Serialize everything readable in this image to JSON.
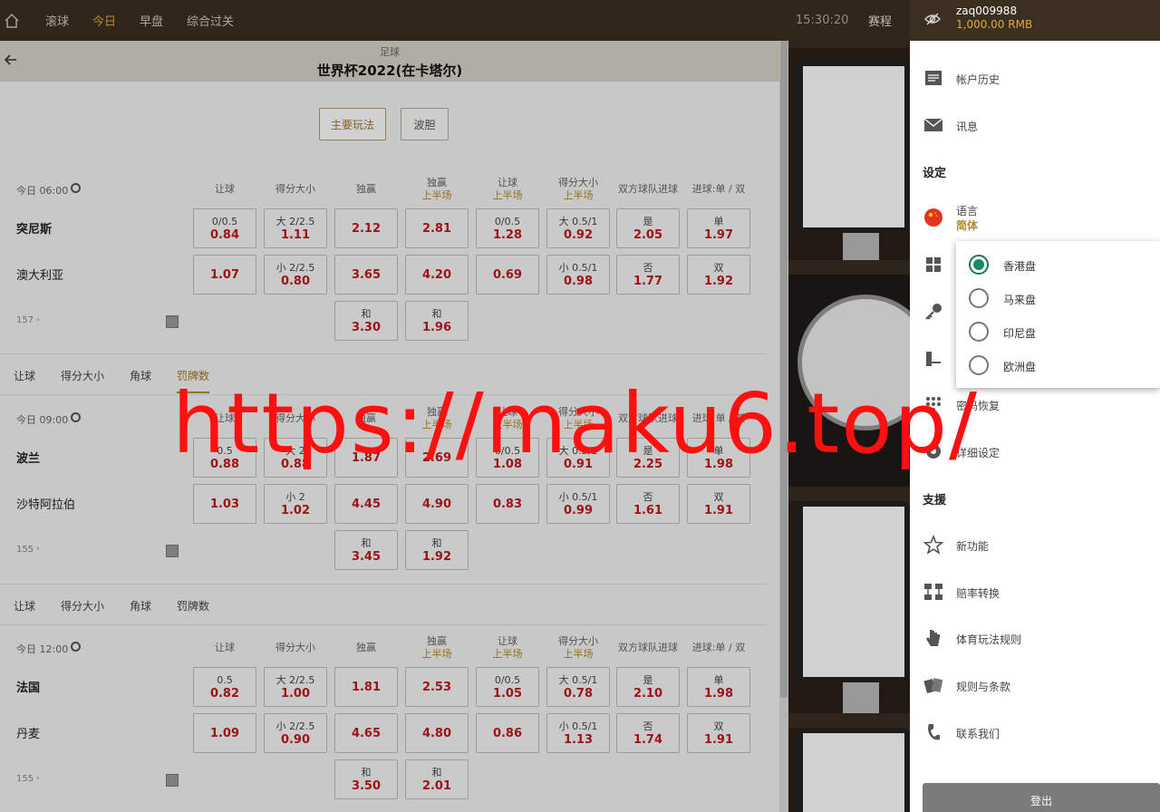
{
  "nav": {
    "items": [
      "滚球",
      "今日",
      "早盘",
      "综合过关"
    ],
    "active": 1,
    "time": "15:30:20",
    "schedule": "赛程"
  },
  "header": {
    "sport": "足球",
    "title": "世界杯2022(在卡塔尔)"
  },
  "tabs": {
    "main": "主要玩法",
    "correct_score": "波胆"
  },
  "columns": [
    {
      "l1": "让球",
      "l2": ""
    },
    {
      "l1": "得分大小",
      "l2": ""
    },
    {
      "l1": "独赢",
      "l2": ""
    },
    {
      "l1": "独赢",
      "l2": "上半场"
    },
    {
      "l1": "让球",
      "l2": "上半场"
    },
    {
      "l1": "得分大小",
      "l2": "上半场"
    },
    {
      "l1": "双方球队进球",
      "l2": ""
    },
    {
      "l1": "进球:单 / 双",
      "l2": ""
    }
  ],
  "matches": [
    {
      "time": "今日 06:00",
      "team1": "突尼斯",
      "team2": "澳大利亚",
      "more": "157",
      "row1": [
        [
          "0/0.5",
          "0.84"
        ],
        [
          "大 2/2.5",
          "1.11"
        ],
        [
          "",
          "2.12"
        ],
        [
          "",
          "2.81"
        ],
        [
          "0/0.5",
          "1.28"
        ],
        [
          "大 0.5/1",
          "0.92"
        ],
        [
          "是",
          "2.05"
        ],
        [
          "单",
          "1.97"
        ]
      ],
      "row2": [
        [
          "",
          "1.07"
        ],
        [
          "小 2/2.5",
          "0.80"
        ],
        [
          "",
          "3.65"
        ],
        [
          "",
          "4.20"
        ],
        [
          "",
          "0.69"
        ],
        [
          "小 0.5/1",
          "0.98"
        ],
        [
          "否",
          "1.77"
        ],
        [
          "双",
          "1.92"
        ]
      ],
      "draw": [
        [
          "和",
          "3.30"
        ],
        [
          "和",
          "1.96"
        ]
      ]
    },
    {
      "time": "今日 09:00",
      "team1": "波兰",
      "team2": "沙特阿拉伯",
      "more": "155",
      "row1": [
        [
          "0.5",
          "0.88"
        ],
        [
          "大 2",
          "0.88"
        ],
        [
          "",
          "1.87"
        ],
        [
          "",
          "2.69"
        ],
        [
          "0/0.5",
          "1.08"
        ],
        [
          "大 0.5/1",
          "0.91"
        ],
        [
          "是",
          "2.25"
        ],
        [
          "单",
          "1.98"
        ]
      ],
      "row2": [
        [
          "",
          "1.03"
        ],
        [
          "小 2",
          "1.02"
        ],
        [
          "",
          "4.45"
        ],
        [
          "",
          "4.90"
        ],
        [
          "",
          "0.83"
        ],
        [
          "小 0.5/1",
          "0.99"
        ],
        [
          "否",
          "1.61"
        ],
        [
          "双",
          "1.91"
        ]
      ],
      "draw": [
        [
          "和",
          "3.45"
        ],
        [
          "和",
          "1.92"
        ]
      ]
    },
    {
      "time": "今日 12:00",
      "team1": "法国",
      "team2": "丹麦",
      "more": "155",
      "row1": [
        [
          "0.5",
          "0.82"
        ],
        [
          "大 2/2.5",
          "1.00"
        ],
        [
          "",
          "1.81"
        ],
        [
          "",
          "2.53"
        ],
        [
          "0/0.5",
          "1.05"
        ],
        [
          "大 0.5/1",
          "0.78"
        ],
        [
          "是",
          "2.10"
        ],
        [
          "单",
          "1.98"
        ]
      ],
      "row2": [
        [
          "",
          "1.09"
        ],
        [
          "小 2/2.5",
          "0.90"
        ],
        [
          "",
          "4.65"
        ],
        [
          "",
          "4.80"
        ],
        [
          "",
          "0.86"
        ],
        [
          "小 0.5/1",
          "1.13"
        ],
        [
          "否",
          "1.74"
        ],
        [
          "双",
          "1.91"
        ]
      ],
      "draw": [
        [
          "和",
          "3.50"
        ],
        [
          "和",
          "2.01"
        ]
      ]
    }
  ],
  "subtabs": [
    "让球",
    "得分大小",
    "角球",
    "罚牌数"
  ],
  "subtabs_active": [
    3,
    -1
  ],
  "drawer": {
    "username": "zaq009988",
    "balance": "1,000.00  RMB",
    "account_history": "帐户历史",
    "messages": "讯息",
    "settings_title": "设定",
    "language": "语言",
    "language_value": "简体",
    "password_recovery": "密码恢复",
    "detail_settings": "详细设定",
    "support_title": "支援",
    "new_features": "新功能",
    "odds_conversion": "赔率转换",
    "sports_rules": "体育玩法规则",
    "terms": "规则与条款",
    "contact": "联系我们",
    "logout": "登出"
  },
  "odds_format": {
    "options": [
      "香港盘",
      "马来盘",
      "印尼盘",
      "欧洲盘"
    ],
    "selected": 0
  },
  "watermark": "https://maku6.top/",
  "colors": {
    "topbar": "#3b2f22",
    "accent": "#e0a83a",
    "odds": "#c0181d",
    "watermark": "#ff1010"
  }
}
